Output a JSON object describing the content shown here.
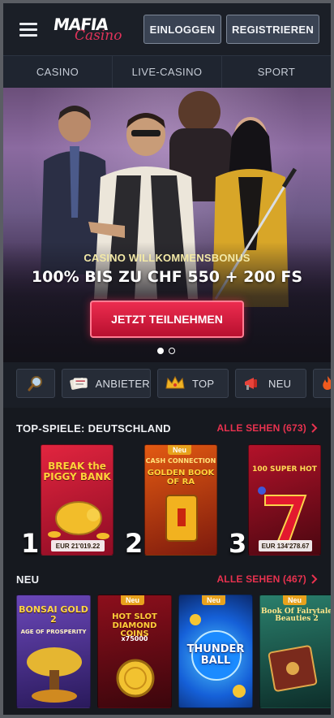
{
  "header": {
    "logo_top": "MAFIA",
    "logo_bottom": "Casino",
    "login_label": "EINLOGGEN",
    "register_label": "REGISTRIEREN"
  },
  "nav": {
    "items": [
      "CASINO",
      "LIVE-CASINO",
      "SPORT"
    ]
  },
  "hero": {
    "subtitle": "CASINO WILLKOMMENSBONUS",
    "title": "100% BIS ZU CHF 550 + 200 FS",
    "cta_label": "JETZT TEILNEHMEN",
    "slides": 2,
    "active_slide": 1
  },
  "filters": {
    "search_icon": "magnifier-icon",
    "items": [
      {
        "label": "ANBIETER",
        "icon": "provider-cards-icon"
      },
      {
        "label": "TOP",
        "icon": "crown-icon"
      },
      {
        "label": "NEU",
        "icon": "megaphone-icon"
      }
    ]
  },
  "top_games": {
    "title": "TOP-SPIELE: DEUTSCHLAND",
    "link": "ALLE SEHEN (673)",
    "games": [
      {
        "rank": "1",
        "name": "BREAK the PIGGY BANK",
        "jackpot": "EUR 21'019.22",
        "colors": [
          "#d81f3b",
          "#8e0c24"
        ]
      },
      {
        "rank": "2",
        "name": "GOLDEN BOOK OF RA",
        "brand": "CASH CONNECTION",
        "badge": "Neu",
        "colors": [
          "#e05a12",
          "#7d1a0d"
        ]
      },
      {
        "rank": "3",
        "name": "100 SUPER HOT",
        "jackpot": "EUR 134'278.67",
        "colors": [
          "#b3122a",
          "#4a0710"
        ]
      }
    ]
  },
  "new_games": {
    "title": "NEU",
    "link": "ALLE SEHEN (467)",
    "games": [
      {
        "name": "BONSAI GOLD 2",
        "tagline": "AGE OF PROSPERITY",
        "colors": [
          "#5b3aa0",
          "#2a1a5c"
        ]
      },
      {
        "name": "HOT SLOT DIAMOND COINS",
        "sub": "x75000",
        "badge": "Neu",
        "colors": [
          "#8c0f1c",
          "#3b060c"
        ]
      },
      {
        "name": "THUNDER BALL",
        "badge": "Neu",
        "colors": [
          "#1560d8",
          "#0b2a6e"
        ]
      },
      {
        "name": "Book Of Fairytale Beauties 2",
        "badge": "Neu",
        "colors": [
          "#1f6a5c",
          "#0d2e2a"
        ]
      }
    ]
  }
}
